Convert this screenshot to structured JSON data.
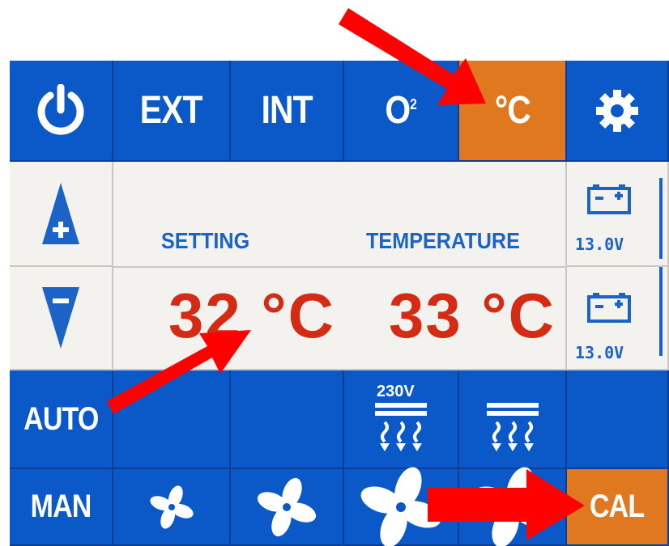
{
  "top_row": {
    "power_icon": "power-icon",
    "ext": "EXT",
    "int": "INT",
    "o2": "O",
    "o2_sup": "2",
    "celsius": "°C",
    "settings_icon": "gear-icon"
  },
  "display": {
    "setting_label": "SETTING",
    "temperature_label": "TEMPERATURE",
    "setting_value": "32 °C",
    "temperature_value": "33 °C",
    "battery1_voltage": "13.0V",
    "battery2_voltage": "13.0V"
  },
  "modes": {
    "auto": "AUTO",
    "man": "MAN",
    "cal": "CAL",
    "heater_230v_label": "230V"
  },
  "colors": {
    "accent_blue": "#0b59c9",
    "highlight_orange": "#e07820",
    "value_red": "#d52a14",
    "arrow_red": "#ff0000"
  }
}
